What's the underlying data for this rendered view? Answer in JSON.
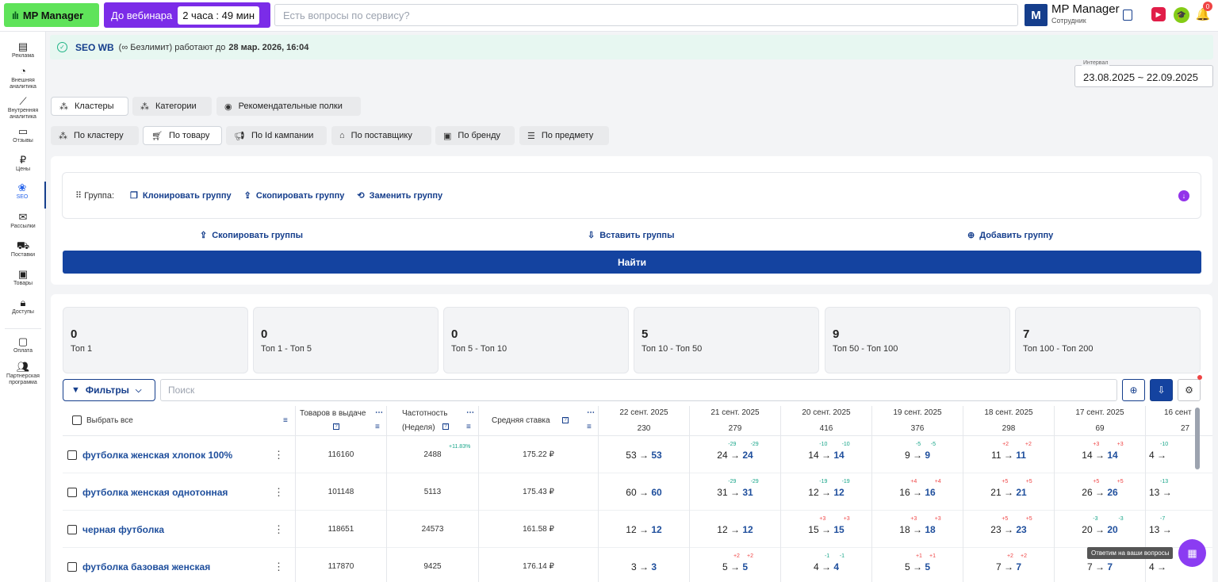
{
  "topbar": {
    "logo": "MP Manager",
    "webinar_label": "До вебинара",
    "webinar_time": "2 часа : 49 мин",
    "search_placeholder": "Есть вопросы по сервису?",
    "user_initial": "M",
    "user_name": "MP Manager",
    "user_role": "Сотрудник",
    "notifications": "0"
  },
  "sidebar": {
    "items": [
      {
        "label": "Реклама",
        "icon": "ad-icon"
      },
      {
        "label": "Внешняя аналитика",
        "icon": "external-analytics-icon"
      },
      {
        "label": "Внутренняя аналитика",
        "icon": "internal-analytics-icon"
      },
      {
        "label": "Отзывы",
        "icon": "reviews-icon"
      },
      {
        "label": "Цены",
        "icon": "ruble-icon"
      },
      {
        "label": "SEO",
        "icon": "seo-icon"
      },
      {
        "label": "Рассылки",
        "icon": "mail-icon"
      },
      {
        "label": "Поставки",
        "icon": "truck-icon"
      },
      {
        "label": "Товары",
        "icon": "box-icon"
      },
      {
        "label": "Доступы",
        "icon": "lock-icon"
      },
      {
        "label": "Оплата",
        "icon": "wallet-icon"
      },
      {
        "label": "Партнерская программа",
        "icon": "partners-icon"
      }
    ],
    "active": "SEO"
  },
  "banner": {
    "title": "SEO WB",
    "text": "(∞ Безлимит) работают до",
    "until": "28 мар. 2026, 16:04"
  },
  "interval": {
    "label": "Интервал",
    "value": "23.08.2025 ~ 22.09.2025"
  },
  "tabs_main": [
    "Кластеры",
    "Категории",
    "Рекомендательные полки"
  ],
  "tabs_sub": [
    "По кластеру",
    "По товару",
    "По Id кампании",
    "По поставщику",
    "По бренду",
    "По предмету"
  ],
  "group": {
    "label": "Группа:",
    "clone": "Клонировать группу",
    "copy": "Скопировать группу",
    "replace": "Заменить группу",
    "copy_groups": "Скопировать группы",
    "paste_groups": "Вставить группы",
    "add_group": "Добавить группу",
    "find": "Найти"
  },
  "stats": [
    {
      "value": "0",
      "label": "Топ 1"
    },
    {
      "value": "0",
      "label": "Топ 1 - Топ 5"
    },
    {
      "value": "0",
      "label": "Топ 5 - Топ 10"
    },
    {
      "value": "5",
      "label": "Топ 10 - Топ 50"
    },
    {
      "value": "9",
      "label": "Топ 50 - Топ 100"
    },
    {
      "value": "7",
      "label": "Топ 100 - Топ 200"
    }
  ],
  "filters": {
    "button": "Фильтры",
    "search_placeholder": "Поиск"
  },
  "table": {
    "select_all": "Выбрать все",
    "col_products": "Товаров в выдаче",
    "col_freq_1": "Частотность",
    "col_freq_2": "(Неделя)",
    "col_bid": "Средняя ставка",
    "dates": [
      {
        "date": "22 сент. 2025",
        "total": "230"
      },
      {
        "date": "21 сент. 2025",
        "total": "279"
      },
      {
        "date": "20 сент. 2025",
        "total": "416"
      },
      {
        "date": "19 сент. 2025",
        "total": "376"
      },
      {
        "date": "18 сент. 2025",
        "total": "298"
      },
      {
        "date": "17 сент. 2025",
        "total": "69"
      },
      {
        "date": "16 сент",
        "total": "27"
      }
    ],
    "rows": [
      {
        "kw": "футболка женская хлопок 100%",
        "products": "116160",
        "freq": "2488",
        "freq_change": "+11.83%",
        "bid": "175.22 ₽",
        "pos": [
          {
            "from": "53",
            "to": "53",
            "d": ""
          },
          {
            "from": "24",
            "to": "24",
            "d": "-29"
          },
          {
            "from": "14",
            "to": "14",
            "d": "-10"
          },
          {
            "from": "9",
            "to": "9",
            "d": "-5"
          },
          {
            "from": "11",
            "to": "11",
            "d": "+2"
          },
          {
            "from": "14",
            "to": "14",
            "d": "+3"
          },
          {
            "from": "4",
            "to": "",
            "d": "-10"
          }
        ]
      },
      {
        "kw": "футболка женская однотонная",
        "products": "101148",
        "freq": "5113",
        "freq_change": "",
        "bid": "175.43 ₽",
        "pos": [
          {
            "from": "60",
            "to": "60",
            "d": ""
          },
          {
            "from": "31",
            "to": "31",
            "d": "-29"
          },
          {
            "from": "12",
            "to": "12",
            "d": "-19"
          },
          {
            "from": "16",
            "to": "16",
            "d": "+4"
          },
          {
            "from": "21",
            "to": "21",
            "d": "+5"
          },
          {
            "from": "26",
            "to": "26",
            "d": "+5"
          },
          {
            "from": "13",
            "to": "",
            "d": "-13"
          }
        ]
      },
      {
        "kw": "черная футболка",
        "products": "118651",
        "freq": "24573",
        "freq_change": "",
        "bid": "161.58 ₽",
        "pos": [
          {
            "from": "12",
            "to": "12",
            "d": ""
          },
          {
            "from": "12",
            "to": "12",
            "d": ""
          },
          {
            "from": "15",
            "to": "15",
            "d": "+3"
          },
          {
            "from": "18",
            "to": "18",
            "d": "+3"
          },
          {
            "from": "23",
            "to": "23",
            "d": "+5"
          },
          {
            "from": "20",
            "to": "20",
            "d": "-3"
          },
          {
            "from": "13",
            "to": "",
            "d": "-7"
          }
        ]
      },
      {
        "kw": "футболка базовая женская",
        "products": "117870",
        "freq": "9425",
        "freq_change": "",
        "bid": "176.14 ₽",
        "pos": [
          {
            "from": "3",
            "to": "3",
            "d": ""
          },
          {
            "from": "5",
            "to": "5",
            "d": "+2"
          },
          {
            "from": "4",
            "to": "4",
            "d": "-1"
          },
          {
            "from": "5",
            "to": "5",
            "d": "+1"
          },
          {
            "from": "7",
            "to": "7",
            "d": "+2"
          },
          {
            "from": "7",
            "to": "7",
            "d": ""
          },
          {
            "from": "4",
            "to": "",
            "d": ""
          }
        ]
      }
    ]
  },
  "chat": {
    "tooltip": "Ответим на ваши вопросы"
  }
}
